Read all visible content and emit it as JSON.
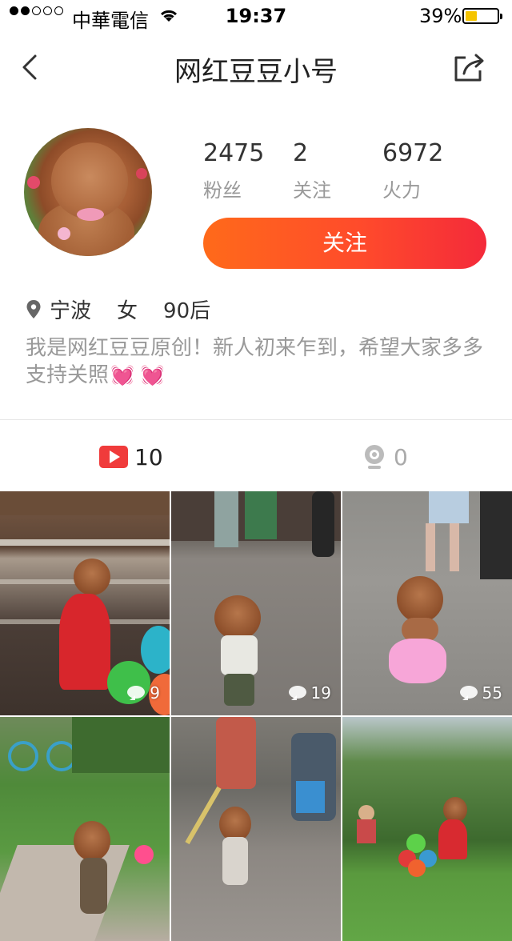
{
  "status_bar": {
    "carrier": "中華電信",
    "time": "19:37",
    "battery": "39%"
  },
  "nav": {
    "title": "网红豆豆小号",
    "back_icon": "chevron-left-icon",
    "share_icon": "share-icon"
  },
  "profile": {
    "stats": [
      {
        "value": "2475",
        "label": "粉丝"
      },
      {
        "value": "2",
        "label": "关注"
      },
      {
        "value": "6972",
        "label": "火力"
      }
    ],
    "follow_label": "关注",
    "location": "宁波",
    "gender": "女",
    "age_group": "90后",
    "bio": "我是网红豆豆原创！新人初来乍到，希望大家多多支持关照",
    "bio_emoji": "💓 💓"
  },
  "tabs": {
    "video": {
      "icon": "video-play-icon",
      "count": "10"
    },
    "live": {
      "icon": "webcam-icon",
      "count": "0"
    }
  },
  "videos": [
    {
      "comments": "9"
    },
    {
      "comments": "19"
    },
    {
      "comments": "55"
    },
    {
      "comments": ""
    },
    {
      "comments": ""
    },
    {
      "comments": ""
    }
  ],
  "colors": {
    "accent_start": "#ff6a1a",
    "accent_end": "#f42a3a",
    "video_icon": "#f03b3b",
    "muted_text": "#999999"
  }
}
